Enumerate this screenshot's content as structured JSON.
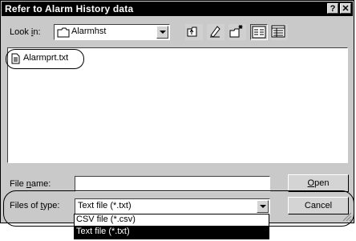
{
  "window": {
    "title": "Refer to Alarm History data",
    "help_label": "?",
    "close_label": "✕"
  },
  "look_in": {
    "label_pre": "Look ",
    "label_accel": "i",
    "label_post": "n:",
    "value": "Alarmhst"
  },
  "toolbar": {
    "icons": [
      "up-folder-icon",
      "desktop-icon",
      "new-folder-icon",
      "list-view-icon",
      "details-view-icon"
    ]
  },
  "files": [
    {
      "name": "Alarmprt.txt",
      "icon": "text-file-icon"
    }
  ],
  "file_name": {
    "label_pre": "File ",
    "label_accel": "n",
    "label_post": "ame:",
    "value": ""
  },
  "files_of_type": {
    "label_pre": "Files of ",
    "label_accel": "t",
    "label_post": "ype:",
    "selected": "Text file (*.txt)",
    "options": [
      "CSV file (*.csv)",
      "Text file (*.txt)"
    ],
    "highlighted_index": 1
  },
  "buttons": {
    "open_accel": "O",
    "open_rest": "pen",
    "cancel": "Cancel"
  },
  "colors": {
    "face": "#c9c9c9",
    "titlebar": "#000000",
    "selection": "#000000"
  }
}
